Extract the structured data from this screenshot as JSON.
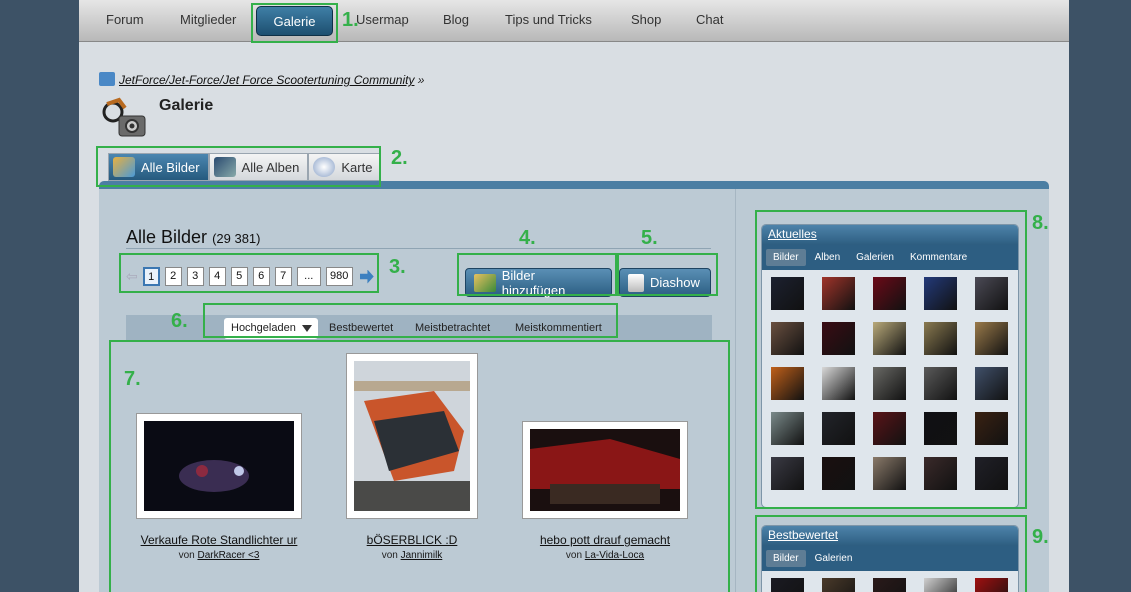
{
  "nav": {
    "items": [
      "Forum",
      "Mitglieder",
      "Galerie",
      "Usermap",
      "Blog",
      "Tips und Tricks",
      "Shop",
      "Chat"
    ],
    "active": "Galerie"
  },
  "breadcrumb": "JetForce/Jet-Force/Jet Force Scootertuning Community",
  "breadcrumb_sep": "»",
  "page_title": "Galerie",
  "tabs": {
    "all_images": "Alle Bilder",
    "all_albums": "Alle Alben",
    "map": "Karte"
  },
  "main": {
    "title": "Alle Bilder",
    "count": "(29 381)",
    "pager": [
      "1",
      "2",
      "3",
      "4",
      "5",
      "6",
      "7",
      "...",
      "980"
    ],
    "current_page": "1",
    "add_images_label": "Bilder hinzufügen",
    "slideshow_label": "Diashow"
  },
  "sort": {
    "active": "Hochgeladen",
    "options": [
      "Bestbewertet",
      "Meistbetrachtet",
      "Meistkommentiert"
    ]
  },
  "thumbnails": [
    {
      "title": "Verkaufe Rote Standlichter ur",
      "by": "von",
      "user": "DarkRacer <3",
      "colors": [
        "#0a0b14",
        "#3a2d52",
        "#8c2a40"
      ]
    },
    {
      "title": "bÖSERBLICK :D",
      "by": "von",
      "user": "Jannimilk",
      "colors": [
        "#cfd5db",
        "#c9552b",
        "#2b3036"
      ]
    },
    {
      "title": "hebo pott drauf gemacht",
      "by": "von",
      "user": "La-Vida-Loca",
      "colors": [
        "#1a0f0f",
        "#8a1616",
        "#3a2a22"
      ]
    }
  ],
  "sidebar": {
    "recent": {
      "title": "Aktuelles",
      "tabs": [
        "Bilder",
        "Alben",
        "Galerien",
        "Kommentare"
      ],
      "active_tab": "Bilder",
      "colors": [
        "#1c2130",
        "#a0342a",
        "#6b0a18",
        "#233a7a",
        "#4b4a55",
        "#6a5040",
        "#3a0c14",
        "#b9aa7a",
        "#8a7a50",
        "#9a7a4a",
        "#c0601a",
        "#d8d8d8",
        "#6a6a66",
        "#5a5a5a",
        "#40506a",
        "#7a8a8a",
        "#22242a",
        "#5a1418",
        "#101014",
        "#3a2212",
        "#3a3a44",
        "#1a1010",
        "#8a7a6a",
        "#3a2a2a",
        "#202028"
      ]
    },
    "top_rated": {
      "title": "Bestbewertet",
      "tabs": [
        "Bilder",
        "Galerien"
      ],
      "active_tab": "Bilder",
      "colors": [
        "#1a1a22",
        "#4a3a2a",
        "#2a1a1a",
        "#d0d0d0",
        "#a01010"
      ]
    }
  },
  "annotations": [
    "1.",
    "2.",
    "3.",
    "4.",
    "5.",
    "6.",
    "7.",
    "8.",
    "9."
  ],
  "colors": {
    "accent": "#2d5e82",
    "annotation": "#34b04a",
    "background": "#3d5266"
  }
}
